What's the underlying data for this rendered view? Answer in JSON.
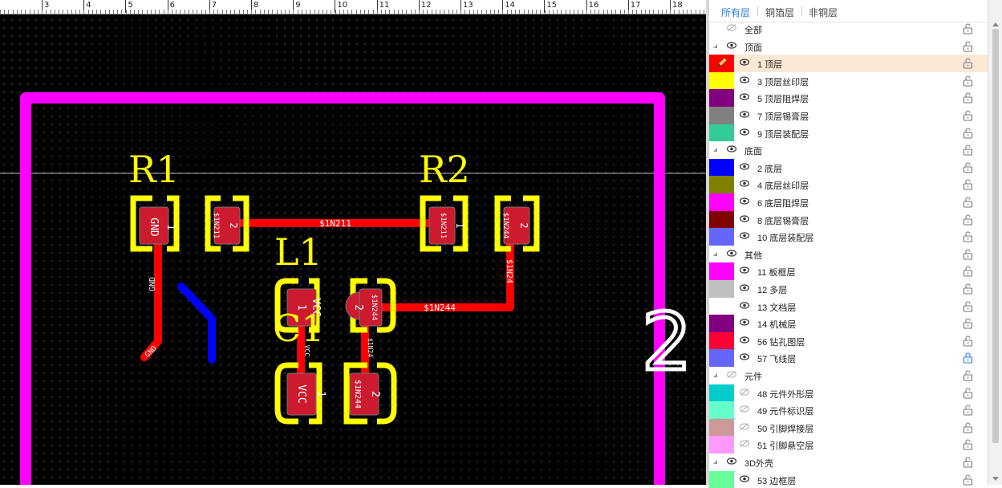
{
  "ruler": {
    "labels": [
      "3",
      "4",
      "5",
      "6",
      "7",
      "8",
      "9",
      "10",
      "11",
      "12",
      "13",
      "14",
      "15",
      "16",
      "17",
      "18"
    ]
  },
  "pcb": {
    "colors": {
      "background": "#000000",
      "board_outline": "#ff00ff",
      "top_copper": "#ff0000",
      "bottom_copper": "#0000ff",
      "silkscreen": "#ffff00",
      "pad": "#cc1a2e",
      "text": "#ffffff"
    },
    "designators": {
      "r1": "R1",
      "r2": "R2",
      "l1": "L1",
      "c1": "C1"
    },
    "pads": {
      "r1_p1_num": "1",
      "r1_p1_net": "GND",
      "r1_p2_num": "2",
      "r1_p2_net": "$1N211",
      "r2_p1_num": "1",
      "r2_p1_net": "$1N211",
      "r2_p2_num": "2",
      "r2_p2_net": "$1N244",
      "l1_p1_num": "1",
      "l1_p1_net": "VCC",
      "l1_p2_num": "2",
      "l1_p2_net": "$1N244",
      "c1_p1_num": "1",
      "c1_p1_net": "VCC",
      "c1_p2_num": "2",
      "c1_p2_net": "$1N244"
    },
    "trace_labels": {
      "n211": "$1N211",
      "n244_h": "$1N244",
      "n244_v": "$1N24",
      "gnd_v": "GND",
      "gnd_end": "GND",
      "vcc_v": "VCC",
      "n244_short": "$1N24"
    },
    "big_number": "2"
  },
  "panel": {
    "tabs": [
      {
        "label": "所有层",
        "active": true
      },
      {
        "label": "铜箔层",
        "active": false
      },
      {
        "label": "非铜层",
        "active": false
      }
    ],
    "rows": [
      {
        "kind": "all",
        "label": "全部",
        "eye": "hidden-eye-icon",
        "lock": "unlocked"
      },
      {
        "kind": "group",
        "label": "顶面",
        "eye": "eye-icon",
        "lock": "unlocked"
      },
      {
        "kind": "layer",
        "label": "1 顶层",
        "color": "#ff0000",
        "eye": "eye-icon",
        "lock": "unlocked",
        "selected": true,
        "edit": true
      },
      {
        "kind": "layer",
        "label": "3 顶层丝印层",
        "color": "#ffff00",
        "eye": "eye-icon",
        "lock": "unlocked"
      },
      {
        "kind": "layer",
        "label": "5 顶层阻焊层",
        "color": "#800080",
        "eye": "eye-icon",
        "lock": "unlocked"
      },
      {
        "kind": "layer",
        "label": "7 顶层锡膏层",
        "color": "#808080",
        "eye": "eye-icon",
        "lock": "unlocked"
      },
      {
        "kind": "layer",
        "label": "9 顶层装配层",
        "color": "#33cc99",
        "eye": "eye-icon",
        "lock": "unlocked"
      },
      {
        "kind": "group",
        "label": "底面",
        "eye": "eye-icon",
        "lock": "unlocked"
      },
      {
        "kind": "layer",
        "label": "2 底层",
        "color": "#0000ff",
        "eye": "eye-icon",
        "lock": "unlocked"
      },
      {
        "kind": "layer",
        "label": "4 底层丝印层",
        "color": "#808000",
        "eye": "eye-icon",
        "lock": "unlocked"
      },
      {
        "kind": "layer",
        "label": "6 底层阻焊层",
        "color": "#ff00ff",
        "eye": "eye-icon",
        "lock": "unlocked"
      },
      {
        "kind": "layer",
        "label": "8 底层锡膏层",
        "color": "#800000",
        "eye": "eye-icon",
        "lock": "unlocked"
      },
      {
        "kind": "layer",
        "label": "10 底层装配层",
        "color": "#6666ff",
        "eye": "eye-icon",
        "lock": "unlocked"
      },
      {
        "kind": "group",
        "label": "其他",
        "eye": "eye-icon",
        "lock": "unlocked"
      },
      {
        "kind": "layer",
        "label": "11 板框层",
        "color": "#ff00ff",
        "eye": "eye-icon",
        "lock": "unlocked"
      },
      {
        "kind": "layer",
        "label": "12 多层",
        "color": "#c0c0c0",
        "eye": "eye-icon",
        "lock": "unlocked"
      },
      {
        "kind": "layer",
        "label": "13 文档层",
        "color": "#ffffff",
        "eye": "eye-icon",
        "lock": "unlocked"
      },
      {
        "kind": "layer",
        "label": "14 机械层",
        "color": "#800080",
        "eye": "eye-icon",
        "lock": "unlocked"
      },
      {
        "kind": "layer",
        "label": "56 钻孔图层",
        "color": "#ff0033",
        "eye": "eye-icon",
        "lock": "unlocked"
      },
      {
        "kind": "layer",
        "label": "57 飞线层",
        "color": "#6666ff",
        "eye": "eye-icon",
        "lock": "locked"
      },
      {
        "kind": "group",
        "label": "元件",
        "eye": "hidden-eye-icon",
        "lock": "unlocked"
      },
      {
        "kind": "layer",
        "label": "48 元件外形层",
        "color": "#00cccc",
        "eye": "hidden-eye-icon",
        "lock": "unlocked"
      },
      {
        "kind": "layer",
        "label": "49 元件标识层",
        "color": "#66ffcc",
        "eye": "hidden-eye-icon",
        "lock": "unlocked"
      },
      {
        "kind": "layer",
        "label": "50 引脚焊接层",
        "color": "#cc9999",
        "eye": "hidden-eye-icon",
        "lock": "unlocked"
      },
      {
        "kind": "layer",
        "label": "51 引脚悬空层",
        "color": "#ff99ff",
        "eye": "hidden-eye-icon",
        "lock": "unlocked"
      },
      {
        "kind": "group",
        "label": "3D外壳",
        "eye": "eye-icon",
        "lock": "unlocked"
      },
      {
        "kind": "layer",
        "label": "53 边框层",
        "color": "#66ff99",
        "eye": "eye-icon",
        "lock": "unlocked"
      }
    ]
  }
}
